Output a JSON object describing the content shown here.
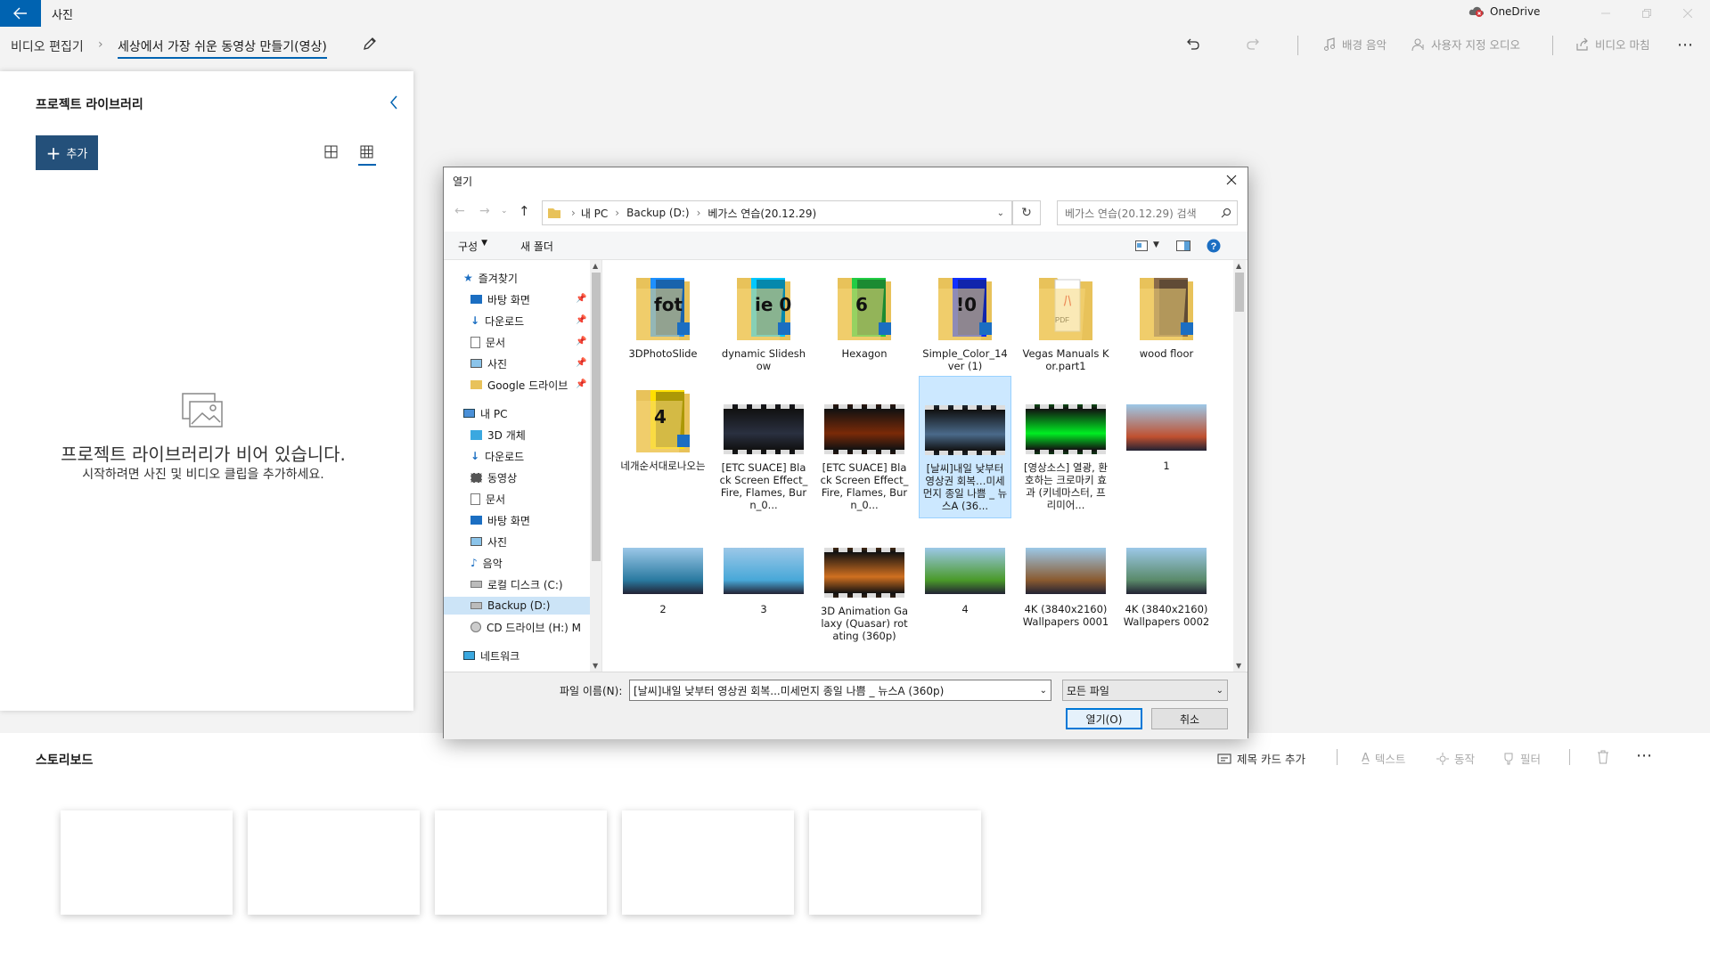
{
  "app": {
    "title": "사진",
    "onedrive": "OneDrive"
  },
  "toolbar": {
    "breadcrumb_root": "비디오 편집기",
    "project_name": "세상에서 가장 쉬운 동영상 만들기(영상)",
    "bg_music": "배경 음악",
    "custom_audio": "사용자 지정 오디오",
    "finish_video": "비디오 마침"
  },
  "library": {
    "title": "프로젝트 라이브러리",
    "add_label": "추가",
    "empty_title": "프로젝트 라이브러리가 비어 있습니다.",
    "empty_subtitle": "시작하려면 사진 및 비디오 클립을 추가하세요."
  },
  "storyboard": {
    "title": "스토리보드",
    "title_card": "제목 카드 추가",
    "text": "텍스트",
    "motion": "동작",
    "filter": "필터"
  },
  "dialog": {
    "title": "열기",
    "path": [
      "내 PC",
      "Backup (D:)",
      "베가스 연습(20.12.29)"
    ],
    "search_placeholder": "베가스 연습(20.12.29) 검색",
    "organize": "구성",
    "new_folder": "새 폴더",
    "nav": {
      "quick_access": "즐겨찾기",
      "qa_items": [
        "바탕 화면",
        "다운로드",
        "문서",
        "사진",
        "Google 드라이브"
      ],
      "this_pc": "내 PC",
      "pc_items": [
        "3D 개체",
        "다운로드",
        "동영상",
        "문서",
        "바탕 화면",
        "사진",
        "음악",
        "로컬 디스크 (C:)",
        "Backup (D:)",
        "CD 드라이브 (H:) M"
      ],
      "network": "네트워크"
    },
    "files": [
      {
        "name": "3DPhotoSlide",
        "kind": "folder",
        "color": "#1e90ff",
        "mark": "fot"
      },
      {
        "name": "dynamic Slideshow",
        "kind": "folder",
        "color": "#00c8ff",
        "mark": "ie 0"
      },
      {
        "name": "Hexagon",
        "kind": "folder",
        "color": "#22cc44",
        "mark": "6"
      },
      {
        "name": "Simple_Color_14ver (1)",
        "kind": "folder",
        "color": "#1030ff",
        "mark": "!0"
      },
      {
        "name": "Vegas Manuals Kor.part1",
        "kind": "pdf",
        "color": "#e03030",
        "mark": "PDF"
      },
      {
        "name": "wood floor",
        "kind": "folder",
        "color": "#8b6b4a",
        "mark": ""
      },
      {
        "name": "네개순서대로나오는",
        "kind": "folder",
        "color": "#ffe000",
        "mark": "4"
      },
      {
        "name": "[ETC SUACE] Black Screen Effect_Fire, Flames, Burn_0...",
        "kind": "video",
        "color": "#2a3040"
      },
      {
        "name": "[ETC SUACE] Black Screen Effect_Fire, Flames, Burn_0...",
        "kind": "video",
        "color": "#7a2a08"
      },
      {
        "name": "[날씨]내일 낮부터 영상권 회복…미세먼지 종일 나쁨 _ 뉴스A (36...",
        "kind": "video",
        "color": "#4a6a8a"
      },
      {
        "name": "[영상소스] 열광, 환호하는 크로마키 효과 (키네마스터, 프리미어...",
        "kind": "video",
        "color": "#00ee22"
      },
      {
        "name": "1",
        "kind": "image",
        "color": "#c05030"
      },
      {
        "name": "2",
        "kind": "image",
        "color": "#2a7aa0"
      },
      {
        "name": "3",
        "kind": "image",
        "color": "#48a8d8"
      },
      {
        "name": "3D Animation Galaxy (Quasar) rotating (360p)",
        "kind": "video",
        "color": "#d07020"
      },
      {
        "name": "4",
        "kind": "image",
        "color": "#4a9a2a"
      },
      {
        "name": "4K (3840x2160) Wallpapers 0001",
        "kind": "image",
        "color": "#8a5a30"
      },
      {
        "name": "4K (3840x2160) Wallpapers 0002",
        "kind": "image",
        "color": "#5a8a6a"
      }
    ],
    "filename_label": "파일 이름(N):",
    "filename_value": "[날씨]내일 낮부터 영상권 회복...미세먼지 종일 나쁨 _ 뉴스A (360p)",
    "filetype_value": "모든 파일",
    "open_label": "열기(O)",
    "cancel_label": "취소"
  },
  "colors": {
    "accent": "#0063b1",
    "add_button": "#24507a",
    "selection": "#cce8ff"
  }
}
